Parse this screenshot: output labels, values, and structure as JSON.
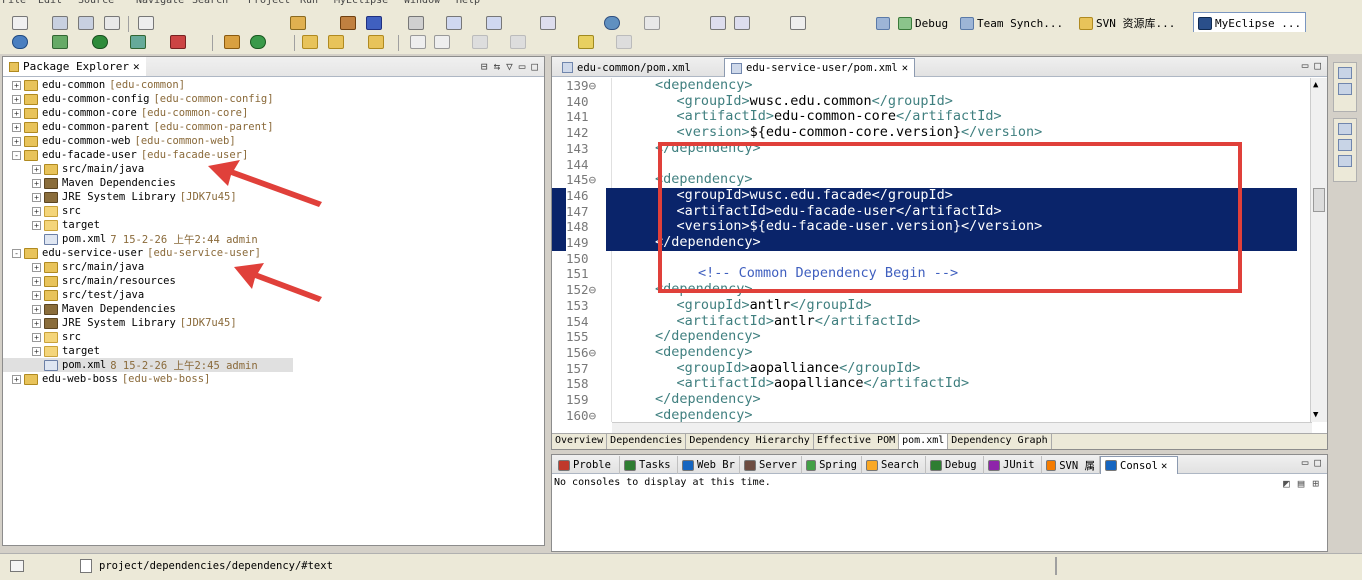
{
  "menu": [
    "File",
    "Edit",
    "Source",
    "Navigate",
    "Search",
    "Project",
    "Run",
    "MyEclipse",
    "Window",
    "Help"
  ],
  "perspectives": [
    {
      "label": "Debug"
    },
    {
      "label": "Team Synch..."
    },
    {
      "label": "SVN 资源库..."
    },
    {
      "label": "MyEclipse ..."
    }
  ],
  "explorer": {
    "title": "Package Explorer",
    "rows": [
      {
        "depth": 0,
        "tw": "+",
        "icon": "proj",
        "label": "edu-common",
        "dec": "[edu-common]"
      },
      {
        "depth": 0,
        "tw": "+",
        "icon": "proj",
        "label": "edu-common-config",
        "dec": "[edu-common-config]"
      },
      {
        "depth": 0,
        "tw": "+",
        "icon": "proj",
        "label": "edu-common-core",
        "dec": "[edu-common-core]"
      },
      {
        "depth": 0,
        "tw": "+",
        "icon": "proj",
        "label": "edu-common-parent",
        "dec": "[edu-common-parent]"
      },
      {
        "depth": 0,
        "tw": "+",
        "icon": "proj",
        "label": "edu-common-web",
        "dec": "[edu-common-web]"
      },
      {
        "depth": 0,
        "tw": "-",
        "icon": "proj",
        "label": "edu-facade-user",
        "dec": "[edu-facade-user]"
      },
      {
        "depth": 1,
        "tw": "+",
        "icon": "src",
        "label": "src/main/java",
        "dec": ""
      },
      {
        "depth": 1,
        "tw": "+",
        "icon": "lib",
        "label": "Maven Dependencies",
        "dec": ""
      },
      {
        "depth": 1,
        "tw": "+",
        "icon": "lib",
        "label": "JRE System Library",
        "dec": "[JDK7u45]"
      },
      {
        "depth": 1,
        "tw": "+",
        "icon": "folder",
        "label": "src",
        "dec": ""
      },
      {
        "depth": 1,
        "tw": "+",
        "icon": "folder",
        "label": "target",
        "dec": ""
      },
      {
        "depth": 1,
        "tw": "",
        "icon": "xml",
        "label": "pom.xml",
        "dec": "7  15-2-26 上午2:44  admin"
      },
      {
        "depth": 0,
        "tw": "-",
        "icon": "proj",
        "label": "edu-service-user",
        "dec": "[edu-service-user]"
      },
      {
        "depth": 1,
        "tw": "+",
        "icon": "src",
        "label": "src/main/java",
        "dec": ""
      },
      {
        "depth": 1,
        "tw": "+",
        "icon": "src",
        "label": "src/main/resources",
        "dec": ""
      },
      {
        "depth": 1,
        "tw": "+",
        "icon": "src",
        "label": "src/test/java",
        "dec": ""
      },
      {
        "depth": 1,
        "tw": "+",
        "icon": "lib",
        "label": "Maven Dependencies",
        "dec": ""
      },
      {
        "depth": 1,
        "tw": "+",
        "icon": "lib",
        "label": "JRE System Library",
        "dec": "[JDK7u45]"
      },
      {
        "depth": 1,
        "tw": "+",
        "icon": "folder",
        "label": "src",
        "dec": ""
      },
      {
        "depth": 1,
        "tw": "+",
        "icon": "folder",
        "label": "target",
        "dec": ""
      },
      {
        "depth": 1,
        "tw": "",
        "icon": "xml",
        "label": "pom.xml",
        "dec": "8  15-2-26 上午2:45  admin",
        "selected": true
      },
      {
        "depth": 0,
        "tw": "+",
        "icon": "proj",
        "label": "edu-web-boss",
        "dec": "[edu-web-boss]"
      }
    ]
  },
  "editor": {
    "tabs": [
      {
        "label": "edu-common/pom.xml",
        "active": false
      },
      {
        "label": "edu-service-user/pom.xml",
        "active": true
      }
    ],
    "lines": [
      {
        "n": "139⊖",
        "indent": 2,
        "parts": [
          [
            "tag",
            "<dependency>"
          ]
        ]
      },
      {
        "n": "140",
        "indent": 3,
        "parts": [
          [
            "tag",
            "<groupId>"
          ],
          [
            "txt",
            "wusc.edu.common"
          ],
          [
            "tag",
            "</groupId>"
          ]
        ]
      },
      {
        "n": "141",
        "indent": 3,
        "parts": [
          [
            "tag",
            "<artifactId>"
          ],
          [
            "txt",
            "edu-common-core"
          ],
          [
            "tag",
            "</artifactId>"
          ]
        ]
      },
      {
        "n": "142",
        "indent": 3,
        "parts": [
          [
            "tag",
            "<version>"
          ],
          [
            "txt",
            "${edu-common-core.version}"
          ],
          [
            "tag",
            "</version>"
          ]
        ]
      },
      {
        "n": "143",
        "indent": 2,
        "parts": [
          [
            "tag",
            "</dependency>"
          ]
        ]
      },
      {
        "n": "144",
        "indent": 0,
        "parts": []
      },
      {
        "n": "145⊖",
        "indent": 2,
        "parts": [
          [
            "tag",
            "<dependency>"
          ]
        ]
      },
      {
        "n": "146",
        "indent": 3,
        "parts": [
          [
            "tag",
            "<groupId>"
          ],
          [
            "txt",
            "wusc.edu.facade"
          ],
          [
            "tag",
            "</groupId>"
          ]
        ],
        "sel": true
      },
      {
        "n": "147",
        "indent": 3,
        "parts": [
          [
            "tag",
            "<artifactId>"
          ],
          [
            "txt",
            "edu-facade-user"
          ],
          [
            "tag",
            "</artifactId>"
          ]
        ],
        "sel": true
      },
      {
        "n": "148",
        "indent": 3,
        "parts": [
          [
            "tag",
            "<version>"
          ],
          [
            "txt",
            "${edu-facade-user.version}"
          ],
          [
            "tag",
            "</version>"
          ]
        ],
        "sel": true
      },
      {
        "n": "149",
        "indent": 2,
        "parts": [
          [
            "tag",
            "</dependency>"
          ]
        ],
        "sel": true
      },
      {
        "n": "150",
        "indent": 0,
        "parts": []
      },
      {
        "n": "151",
        "indent": 4,
        "parts": [
          [
            "com",
            "<!-- Common Dependency Begin -->"
          ]
        ]
      },
      {
        "n": "152⊖",
        "indent": 2,
        "parts": [
          [
            "tag",
            "<dependency>"
          ]
        ]
      },
      {
        "n": "153",
        "indent": 3,
        "parts": [
          [
            "tag",
            "<groupId>"
          ],
          [
            "txt",
            "antlr"
          ],
          [
            "tag",
            "</groupId>"
          ]
        ]
      },
      {
        "n": "154",
        "indent": 3,
        "parts": [
          [
            "tag",
            "<artifactId>"
          ],
          [
            "txt",
            "antlr"
          ],
          [
            "tag",
            "</artifactId>"
          ]
        ]
      },
      {
        "n": "155",
        "indent": 2,
        "parts": [
          [
            "tag",
            "</dependency>"
          ]
        ]
      },
      {
        "n": "156⊖",
        "indent": 2,
        "parts": [
          [
            "tag",
            "<dependency>"
          ]
        ]
      },
      {
        "n": "157",
        "indent": 3,
        "parts": [
          [
            "tag",
            "<groupId>"
          ],
          [
            "txt",
            "aopalliance"
          ],
          [
            "tag",
            "</groupId>"
          ]
        ]
      },
      {
        "n": "158",
        "indent": 3,
        "parts": [
          [
            "tag",
            "<artifactId>"
          ],
          [
            "txt",
            "aopalliance"
          ],
          [
            "tag",
            "</artifactId>"
          ]
        ]
      },
      {
        "n": "159",
        "indent": 2,
        "parts": [
          [
            "tag",
            "</dependency>"
          ]
        ]
      },
      {
        "n": "160⊖",
        "indent": 2,
        "parts": [
          [
            "tag",
            "<dependency>"
          ]
        ]
      }
    ],
    "pom_tabs": [
      {
        "label": "Overview",
        "active": false
      },
      {
        "label": "Dependencies",
        "active": false
      },
      {
        "label": "Dependency Hierarchy",
        "active": false
      },
      {
        "label": "Effective POM",
        "active": false
      },
      {
        "label": "pom.xml",
        "active": true
      },
      {
        "label": "Dependency Graph",
        "active": false
      }
    ]
  },
  "console": {
    "tabs": [
      {
        "label": "Proble",
        "color": "#c0392b"
      },
      {
        "label": "Tasks",
        "color": "#2e7d32"
      },
      {
        "label": "Web Br",
        "color": "#1565c0"
      },
      {
        "label": "Server",
        "color": "#6d4c41"
      },
      {
        "label": "Spring",
        "color": "#43a047"
      },
      {
        "label": "Search",
        "color": "#f9a825"
      },
      {
        "label": "Debug",
        "color": "#2e7d32"
      },
      {
        "label": "JUnit",
        "color": "#8e24aa"
      },
      {
        "label": "SVN 属",
        "color": "#f57c00"
      },
      {
        "label": "Consol",
        "color": "#1565c0",
        "active": true
      }
    ],
    "message": "No consoles to display at this time."
  },
  "status": {
    "path": "project/dependencies/dependency/#text"
  },
  "colors": {
    "selection": "#0a246a",
    "annotation_red": "#e0403a",
    "tag": "#3f7f7f",
    "comment": "#3f5fbf"
  }
}
